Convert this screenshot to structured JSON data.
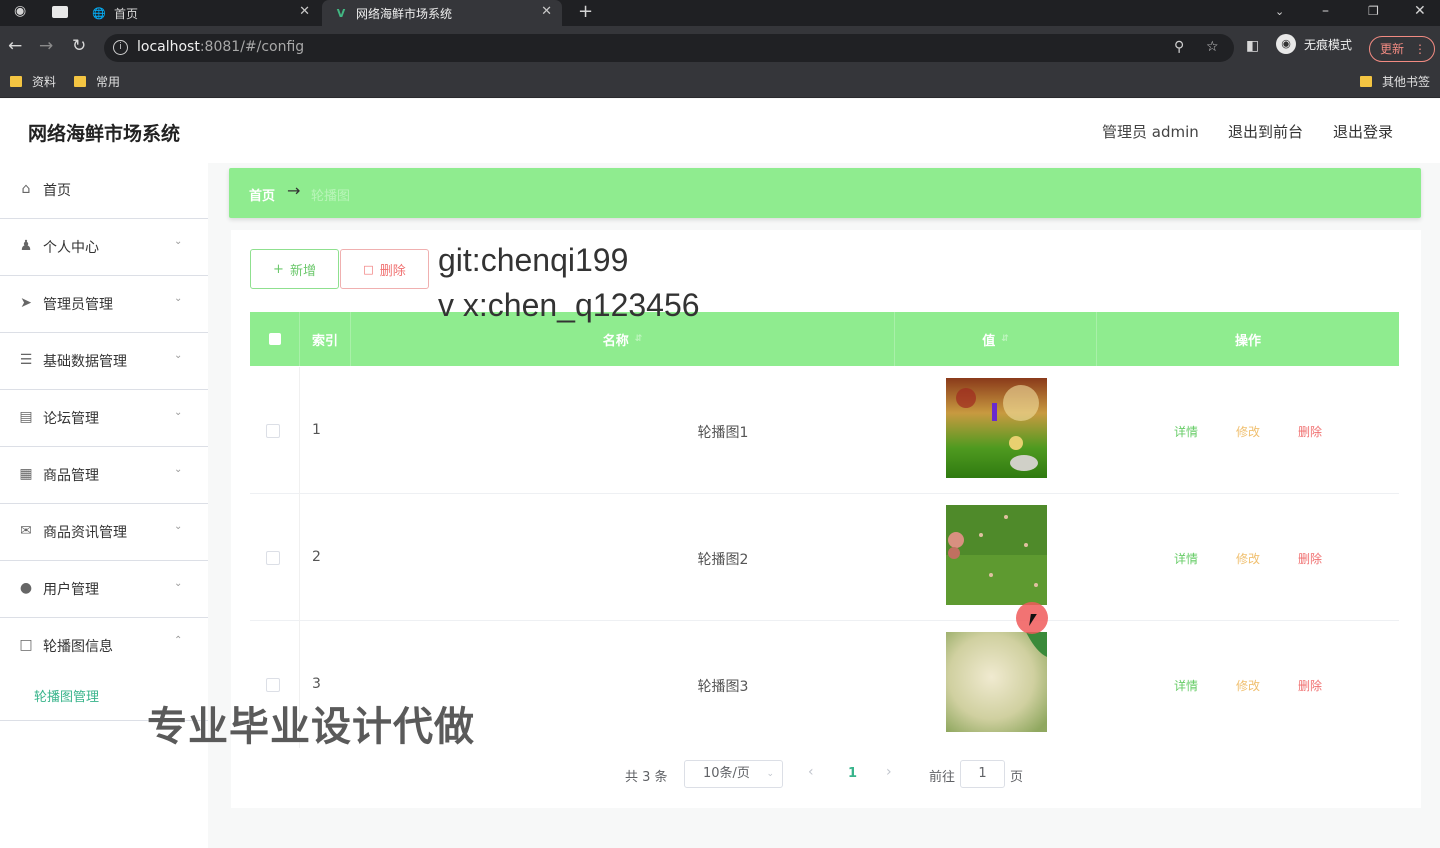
{
  "browser": {
    "tabs": [
      {
        "label": "首页"
      },
      {
        "label": "网络海鲜市场系统"
      }
    ],
    "url_host": "localhost",
    "url_rest": ":8081/#/config",
    "incognito_label": "无痕模式",
    "update_label": "更新",
    "bookmarks": [
      "资料",
      "常用"
    ],
    "other_bookmarks": "其他书签"
  },
  "header": {
    "title": "网络海鲜市场系统",
    "user": "管理员 admin",
    "to_front": "退出到前台",
    "logout": "退出登录"
  },
  "sidebar": {
    "items": [
      {
        "label": "首页",
        "icon": "home-icon"
      },
      {
        "label": "个人中心",
        "icon": "user-icon"
      },
      {
        "label": "管理员管理",
        "icon": "send-icon"
      },
      {
        "label": "基础数据管理",
        "icon": "sliders-icon"
      },
      {
        "label": "论坛管理",
        "icon": "document-icon"
      },
      {
        "label": "商品管理",
        "icon": "grid-icon"
      },
      {
        "label": "商品资讯管理",
        "icon": "mail-icon"
      },
      {
        "label": "用户管理",
        "icon": "pin-icon"
      },
      {
        "label": "轮播图信息",
        "icon": "crop-icon"
      }
    ],
    "sub_item": "轮播图管理",
    "accent": "#38b48b"
  },
  "breadcrumb": {
    "home": "首页",
    "current": "轮播图"
  },
  "toolbar": {
    "add_label": "新增",
    "delete_label": "删除"
  },
  "overlay": {
    "line1": "git:chenqi199",
    "line2": "v x:chen_q123456",
    "watermark": "专业毕业设计代做"
  },
  "table": {
    "columns": {
      "index": "索引",
      "name": "名称",
      "value": "值",
      "actions": "操作"
    },
    "rows": [
      {
        "index": "1",
        "name": "轮播图1"
      },
      {
        "index": "2",
        "name": "轮播图2"
      },
      {
        "index": "3",
        "name": "轮播图3"
      }
    ],
    "actions": {
      "detail": "详情",
      "edit": "修改",
      "delete": "删除"
    },
    "header_color": "#8fec8f"
  },
  "pagination": {
    "total": "共 3 条",
    "page_size": "10条/页",
    "current_page": "1",
    "goto_label": "前往",
    "goto_value": "1",
    "page_unit": "页"
  }
}
